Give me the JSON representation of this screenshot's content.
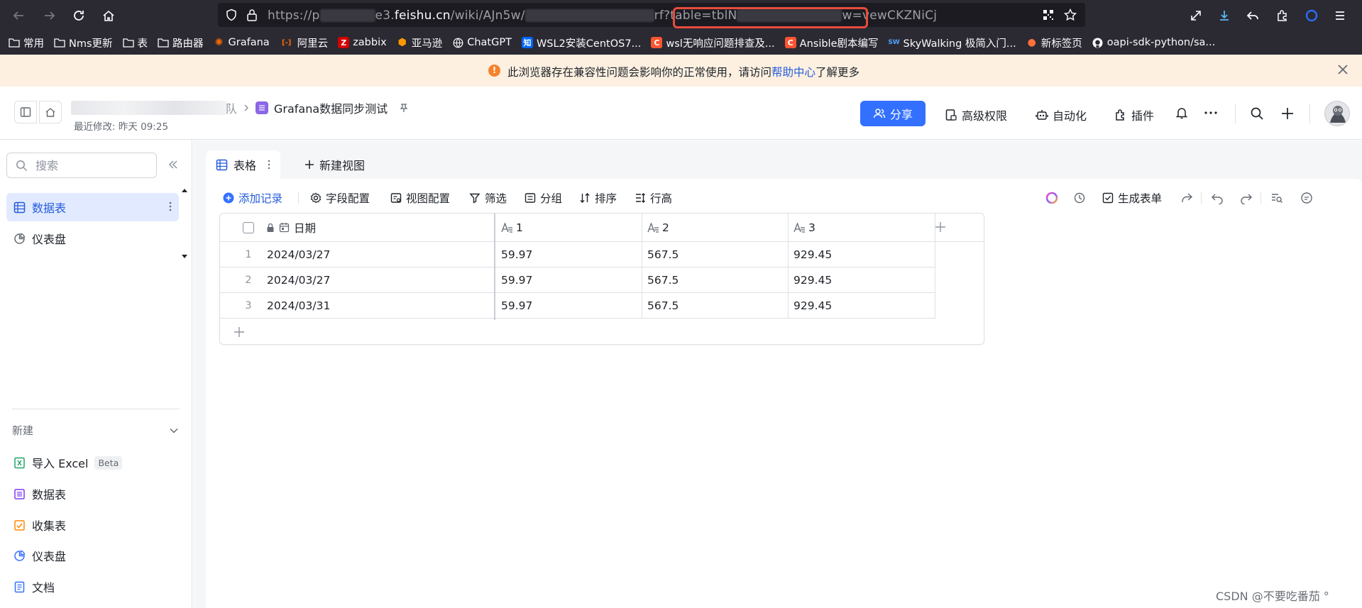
{
  "browser": {
    "url_prefix": "https://p",
    "url_domain_part": "e3.",
    "url_domain": "feishu.cn",
    "url_path": "/wiki/",
    "url_token": "AJn5w/",
    "url_mid": "rf?table=tblN",
    "url_tail": "w=vewCKZNiCj"
  },
  "bookmarks": [
    {
      "label": "常用",
      "icon": "folder-icon"
    },
    {
      "label": "Nms更新",
      "icon": "folder-icon"
    },
    {
      "label": "表",
      "icon": "folder-icon"
    },
    {
      "label": "路由器",
      "icon": "folder-icon"
    },
    {
      "label": "Grafana",
      "icon": "grafana-icon",
      "color": "#f46800"
    },
    {
      "label": "阿里云",
      "icon": "aliyun-icon",
      "color": "#ff6a00"
    },
    {
      "label": "zabbix",
      "icon": "zabbix-icon",
      "color": "#d40000"
    },
    {
      "label": "亚马逊",
      "icon": "aws-icon",
      "color": "#ff9900"
    },
    {
      "label": "ChatGPT",
      "icon": "globe-icon"
    },
    {
      "label": "WSL2安装CentOS7...",
      "icon": "zhihu-icon",
      "color": "#0066ff"
    },
    {
      "label": "wsl无响应问题排查及...",
      "icon": "csdn-icon",
      "color": "#fc5531"
    },
    {
      "label": "Ansible剧本编写",
      "icon": "csdn-icon",
      "color": "#fc5531"
    },
    {
      "label": "SkyWalking 极简入门...",
      "icon": "skywalking-icon",
      "color": "#1f6feb"
    },
    {
      "label": "新标签页",
      "icon": "firefox-icon",
      "color": "#ff7139"
    },
    {
      "label": "oapi-sdk-python/sa...",
      "icon": "github-icon"
    }
  ],
  "warning": {
    "text_before": "此浏览器存在兼容性问题会影响你的正常使用，请访问",
    "link": "帮助中心",
    "text_after": "了解更多"
  },
  "header": {
    "team_suffix": "队",
    "doc_title": "Grafana数据同步测试",
    "last_modified": "最近修改: 昨天 09:25",
    "share_label": "分享",
    "permissions_label": "高级权限",
    "automation_label": "自动化",
    "plugins_label": "插件"
  },
  "sidebar": {
    "search_placeholder": "搜索",
    "items": [
      {
        "label": "数据表",
        "icon": "table-icon",
        "active": true
      },
      {
        "label": "仪表盘",
        "icon": "dashboard-icon",
        "active": false
      }
    ],
    "new_section": {
      "title": "新建",
      "items": [
        {
          "label": "导入 Excel",
          "badge": "Beta",
          "icon": "excel-icon",
          "color": "#21a366"
        },
        {
          "label": "数据表",
          "icon": "table-icon",
          "color": "#7f3bf5"
        },
        {
          "label": "收集表",
          "icon": "form-icon",
          "color": "#ff8800"
        },
        {
          "label": "仪表盘",
          "icon": "dashboard-icon",
          "color": "#3370ff"
        },
        {
          "label": "文档",
          "icon": "doc-icon",
          "color": "#3370ff"
        }
      ]
    }
  },
  "views": {
    "active_tab": "表格",
    "new_view": "新建视图"
  },
  "toolbar": {
    "add_record": "添加记录",
    "field_config": "字段配置",
    "view_config": "视图配置",
    "filter": "筛选",
    "group": "分组",
    "sort": "排序",
    "row_height": "行高",
    "generate_form": "生成表单"
  },
  "table": {
    "columns": [
      "日期",
      "1",
      "2",
      "3"
    ],
    "rows": [
      {
        "num": "1",
        "date": "2024/03/27",
        "c1": "59.97",
        "c2": "567.5",
        "c3": "929.45"
      },
      {
        "num": "2",
        "date": "2024/03/27",
        "c1": "59.97",
        "c2": "567.5",
        "c3": "929.45"
      },
      {
        "num": "3",
        "date": "2024/03/31",
        "c1": "59.97",
        "c2": "567.5",
        "c3": "929.45"
      }
    ]
  },
  "watermark": "CSDN @不要吃番茄 °",
  "colors": {
    "accent": "#3370ff",
    "active_bg": "#e1eaff",
    "banner_bg": "#fdf0e1",
    "url_highlight": "#e74c3c"
  }
}
